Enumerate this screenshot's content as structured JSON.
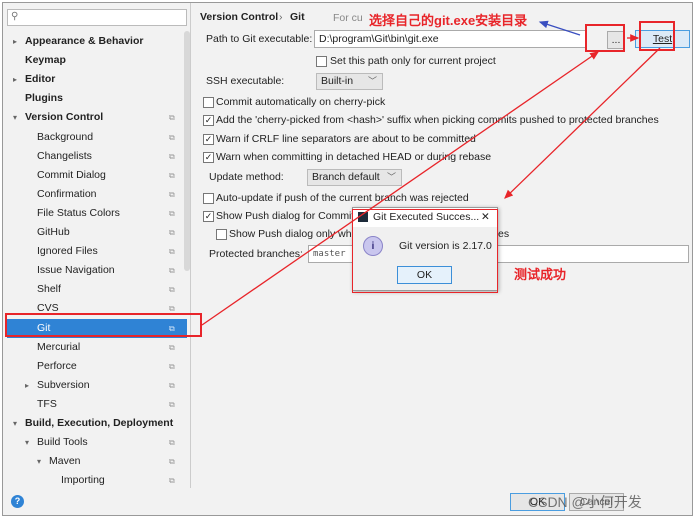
{
  "sidebar": {
    "search_icon": "magnifier",
    "items": [
      {
        "label": "Appearance & Behavior",
        "level": 0,
        "arrow": "right",
        "bold": true
      },
      {
        "label": "Keymap",
        "level": 0,
        "bold": true
      },
      {
        "label": "Editor",
        "level": 0,
        "arrow": "right",
        "bold": true
      },
      {
        "label": "Plugins",
        "level": 0,
        "bold": true
      },
      {
        "label": "Version Control",
        "level": 0,
        "arrow": "down",
        "bold": true,
        "copy": true
      },
      {
        "label": "Background",
        "level": 1,
        "copy": true
      },
      {
        "label": "Changelists",
        "level": 1,
        "copy": true
      },
      {
        "label": "Commit Dialog",
        "level": 1,
        "copy": true
      },
      {
        "label": "Confirmation",
        "level": 1,
        "copy": true
      },
      {
        "label": "File Status Colors",
        "level": 1,
        "copy": true
      },
      {
        "label": "GitHub",
        "level": 1,
        "copy": true
      },
      {
        "label": "Ignored Files",
        "level": 1,
        "copy": true
      },
      {
        "label": "Issue Navigation",
        "level": 1,
        "copy": true
      },
      {
        "label": "Shelf",
        "level": 1,
        "copy": true
      },
      {
        "label": "CVS",
        "level": 1,
        "copy": true
      },
      {
        "label": "Git",
        "level": 1,
        "copy": true,
        "selected": true
      },
      {
        "label": "Mercurial",
        "level": 1,
        "copy": true
      },
      {
        "label": "Perforce",
        "level": 1,
        "copy": true
      },
      {
        "label": "Subversion",
        "level": 1,
        "arrow": "right",
        "copy": true
      },
      {
        "label": "TFS",
        "level": 1,
        "copy": true
      },
      {
        "label": "Build, Execution, Deployment",
        "level": 0,
        "arrow": "down",
        "bold": true
      },
      {
        "label": "Build Tools",
        "level": 1,
        "arrow": "down",
        "copy": true
      },
      {
        "label": "Maven",
        "level": 2,
        "arrow": "down",
        "copy": true
      },
      {
        "label": "Importing",
        "level": 3,
        "copy": true
      }
    ]
  },
  "breadcrumb": {
    "parent": "Version Control",
    "sep": "›",
    "current": "Git",
    "scope": "For cu"
  },
  "settings": {
    "path_label": "Path to Git executable:",
    "path_value": "D:\\program\\Git\\bin\\git.exe",
    "browse_label": "...",
    "test_label": "Test",
    "set_path_only": {
      "label": "Set this path only for current project",
      "checked": false
    },
    "ssh_label": "SSH executable:",
    "ssh_value": "Built-in",
    "commit_auto": {
      "label": "Commit automatically on cherry-pick",
      "checked": false
    },
    "cherry_suffix": {
      "label": "Add the 'cherry-picked from <hash>' suffix when picking commits pushed to protected branches",
      "checked": true
    },
    "warn_crlf": {
      "label": "Warn if CRLF line separators are about to be committed",
      "checked": true
    },
    "warn_detached": {
      "label": "Warn when committing in detached HEAD or during rebase",
      "checked": true
    },
    "update_label": "Update method:",
    "update_value": "Branch default",
    "auto_update": {
      "label": "Auto-update if push of the current branch was rejected",
      "checked": false
    },
    "show_push": {
      "label": "Show Push dialog for Commit a",
      "checked": true
    },
    "show_push_only": {
      "label": "Show Push dialog only when",
      "suffix": "es",
      "checked": false
    },
    "protected_label": "Protected branches:",
    "protected_value": "master"
  },
  "dialog": {
    "title": "Git Executed Succes...",
    "message": "Git version is 2.17.0",
    "ok": "OK",
    "close": "✕"
  },
  "footer": {
    "help": "?",
    "ok": "OK",
    "cancel": "Cancel"
  },
  "annotations": {
    "select_dir": "选择自己的git.exe安装目录",
    "test_ok": "测试成功",
    "watermark": "CSDN @小何开发"
  },
  "colors": {
    "accent": "#2f83d5",
    "annotation": "#e8252a",
    "arrow_blue": "#3a4fc0"
  }
}
